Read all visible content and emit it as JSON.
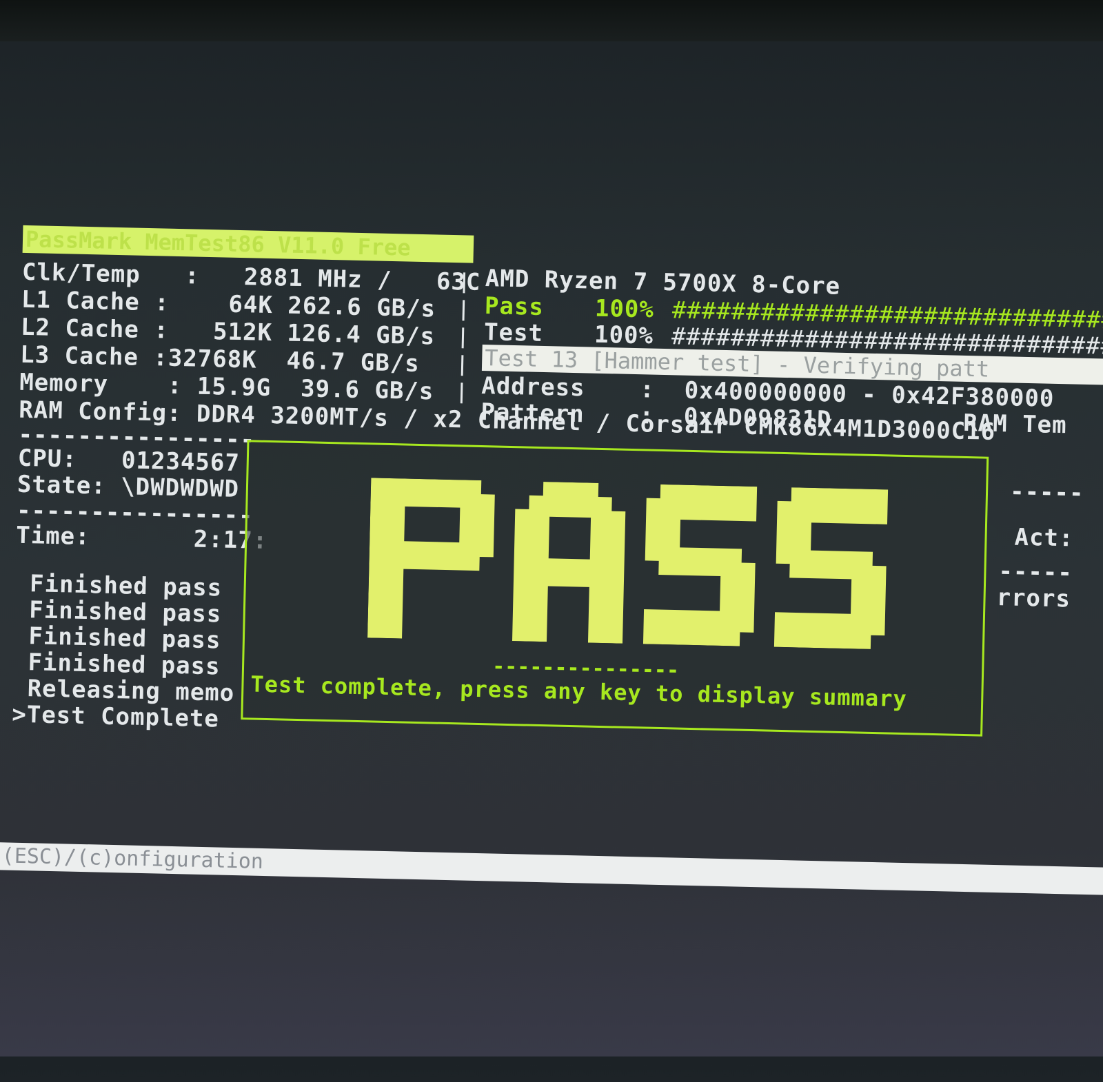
{
  "header": {
    "title": "PassMark MemTest86 V11.0 Free",
    "cpu_model": "AMD Ryzen 7 5700X 8-Core"
  },
  "sysinfo": {
    "clk_temp": "Clk/Temp   :   2881 MHz /   63C",
    "l1": "L1 Cache :    64K 262.6 GB/s",
    "l2": "L2 Cache :   512K 126.4 GB/s",
    "l3": "L3 Cache :32768K  46.7 GB/s",
    "memory": "Memory    : 15.9G  39.6 GB/s",
    "ram_config": "RAM Config: DDR4 3200MT/s / x2 Channel / Corsair CMK8GX4M1D3000C16"
  },
  "progress": {
    "pass_label": "Pass",
    "pass_pct": "100%",
    "pass_bar": "##############################",
    "test_label": "Test",
    "test_pct": "100%",
    "test_bar": "##############################",
    "pass_fraction": 1.0,
    "test_fraction": 1.0
  },
  "current_test": {
    "status": "Test 13 [Hammer test] - Verifying patt",
    "address_label": "Address",
    "address_value": ":  0x400000000 - 0x42F380000",
    "pattern_label": "Pattern",
    "pattern_value": ":  0xAD09831D",
    "ram_temp_label": "RAM Tem"
  },
  "left_panel": {
    "divider": "----------------",
    "cpu": "CPU:   01234567",
    "state": "State: \\DWDWDWD",
    "time": "Time:       2:17:",
    "log": [
      " Finished pass",
      " Finished pass",
      " Finished pass",
      " Finished pass",
      " Releasing memo",
      ">Test Complete"
    ]
  },
  "right_panel": {
    "divider": "-----",
    "act": "Act:",
    "errors": "rrors"
  },
  "result": {
    "big_text": "PASS",
    "divider": "---------------",
    "message": "Test complete, press any key to display summary"
  },
  "footer": {
    "text": "(ESC)/(c)onfiguration"
  },
  "colors": {
    "accent_green": "#a7e81f",
    "title_bg": "#d6f26a",
    "text": "#e4e8ea"
  }
}
